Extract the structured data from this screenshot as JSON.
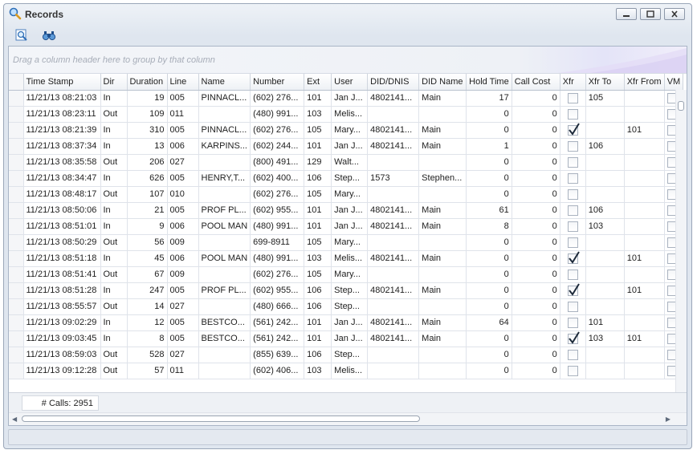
{
  "window": {
    "title": "Records"
  },
  "group_panel": {
    "hint": "Drag a column header here to group by that column"
  },
  "columns": [
    "Time Stamp",
    "Dir",
    "Duration",
    "Line",
    "Name",
    "Number",
    "Ext",
    "User",
    "DID/DNIS",
    "DID Name",
    "Hold Time",
    "Call Cost",
    "Xfr",
    "Xfr To",
    "Xfr From",
    "VM"
  ],
  "rows": [
    [
      "11/21/13 08:21:03",
      "In",
      "19",
      "005",
      "PINNACL...",
      "(602) 276...",
      "101",
      "Jan J...",
      "4802141...",
      "Main",
      "17",
      "0",
      false,
      "105",
      ""
    ],
    [
      "11/21/13 08:23:11",
      "Out",
      "109",
      "011",
      "",
      "(480) 991...",
      "103",
      "Melis...",
      "",
      "",
      "0",
      "0",
      false,
      "",
      ""
    ],
    [
      "11/21/13 08:21:39",
      "In",
      "310",
      "005",
      "PINNACL...",
      "(602) 276...",
      "105",
      "Mary...",
      "4802141...",
      "Main",
      "0",
      "0",
      true,
      "",
      "101"
    ],
    [
      "11/21/13 08:37:34",
      "In",
      "13",
      "006",
      "KARPINS...",
      "(602) 244...",
      "101",
      "Jan J...",
      "4802141...",
      "Main",
      "1",
      "0",
      false,
      "106",
      ""
    ],
    [
      "11/21/13 08:35:58",
      "Out",
      "206",
      "027",
      "",
      "(800) 491...",
      "129",
      "Walt...",
      "",
      "",
      "0",
      "0",
      false,
      "",
      ""
    ],
    [
      "11/21/13 08:34:47",
      "In",
      "626",
      "005",
      "HENRY,T...",
      "(602) 400...",
      "106",
      "Step...",
      "1573",
      "Stephen...",
      "0",
      "0",
      false,
      "",
      ""
    ],
    [
      "11/21/13 08:48:17",
      "Out",
      "107",
      "010",
      "",
      "(602) 276...",
      "105",
      "Mary...",
      "",
      "",
      "0",
      "0",
      false,
      "",
      ""
    ],
    [
      "11/21/13 08:50:06",
      "In",
      "21",
      "005",
      "PROF PL...",
      "(602) 955...",
      "101",
      "Jan J...",
      "4802141...",
      "Main",
      "61",
      "0",
      false,
      "106",
      ""
    ],
    [
      "11/21/13 08:51:01",
      "In",
      "9",
      "006",
      "POOL MAN",
      "(480) 991...",
      "101",
      "Jan J...",
      "4802141...",
      "Main",
      "8",
      "0",
      false,
      "103",
      ""
    ],
    [
      "11/21/13 08:50:29",
      "Out",
      "56",
      "009",
      "",
      "699-8911",
      "105",
      "Mary...",
      "",
      "",
      "0",
      "0",
      false,
      "",
      ""
    ],
    [
      "11/21/13 08:51:18",
      "In",
      "45",
      "006",
      "POOL MAN",
      "(480) 991...",
      "103",
      "Melis...",
      "4802141...",
      "Main",
      "0",
      "0",
      true,
      "",
      "101"
    ],
    [
      "11/21/13 08:51:41",
      "Out",
      "67",
      "009",
      "",
      "(602) 276...",
      "105",
      "Mary...",
      "",
      "",
      "0",
      "0",
      false,
      "",
      ""
    ],
    [
      "11/21/13 08:51:28",
      "In",
      "247",
      "005",
      "PROF PL...",
      "(602) 955...",
      "106",
      "Step...",
      "4802141...",
      "Main",
      "0",
      "0",
      true,
      "",
      "101"
    ],
    [
      "11/21/13 08:55:57",
      "Out",
      "14",
      "027",
      "",
      "(480) 666...",
      "106",
      "Step...",
      "",
      "",
      "0",
      "0",
      false,
      "",
      ""
    ],
    [
      "11/21/13 09:02:29",
      "In",
      "12",
      "005",
      "BESTCO...",
      "(561) 242...",
      "101",
      "Jan J...",
      "4802141...",
      "Main",
      "64",
      "0",
      false,
      "101",
      ""
    ],
    [
      "11/21/13 09:03:45",
      "In",
      "8",
      "005",
      "BESTCO...",
      "(561) 242...",
      "101",
      "Jan J...",
      "4802141...",
      "Main",
      "0",
      "0",
      true,
      "103",
      "101"
    ],
    [
      "11/21/13 08:59:03",
      "Out",
      "528",
      "027",
      "",
      "(855) 639...",
      "106",
      "Step...",
      "",
      "",
      "0",
      "0",
      false,
      "",
      ""
    ],
    [
      "11/21/13 09:12:28",
      "Out",
      "57",
      "011",
      "",
      "(602) 406...",
      "103",
      "Melis...",
      "",
      "",
      "0",
      "0",
      false,
      "",
      ""
    ]
  ],
  "footer": {
    "calls_summary": "# Calls: 2951"
  },
  "icons": {
    "app": "magnifier-icon",
    "toolbar": [
      "zoom-page-icon",
      "binoculars-icon"
    ]
  },
  "colors": {
    "accent": "#2f6fb7",
    "grid_line": "#dfe3ea"
  }
}
